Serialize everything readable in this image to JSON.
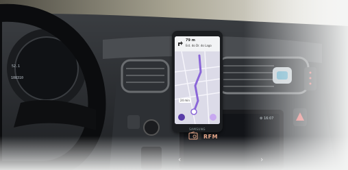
{
  "phone": {
    "nav_time": "79 m",
    "nav_street": "Est. do Dr. do Lago",
    "brand": "SAMSUNG",
    "map_chip": "24 min"
  },
  "dashboard": {
    "radio_label": "RFM",
    "clock": "⚙ 16:07",
    "gauge_top": "52.1",
    "gauge_bottom": "108310"
  }
}
